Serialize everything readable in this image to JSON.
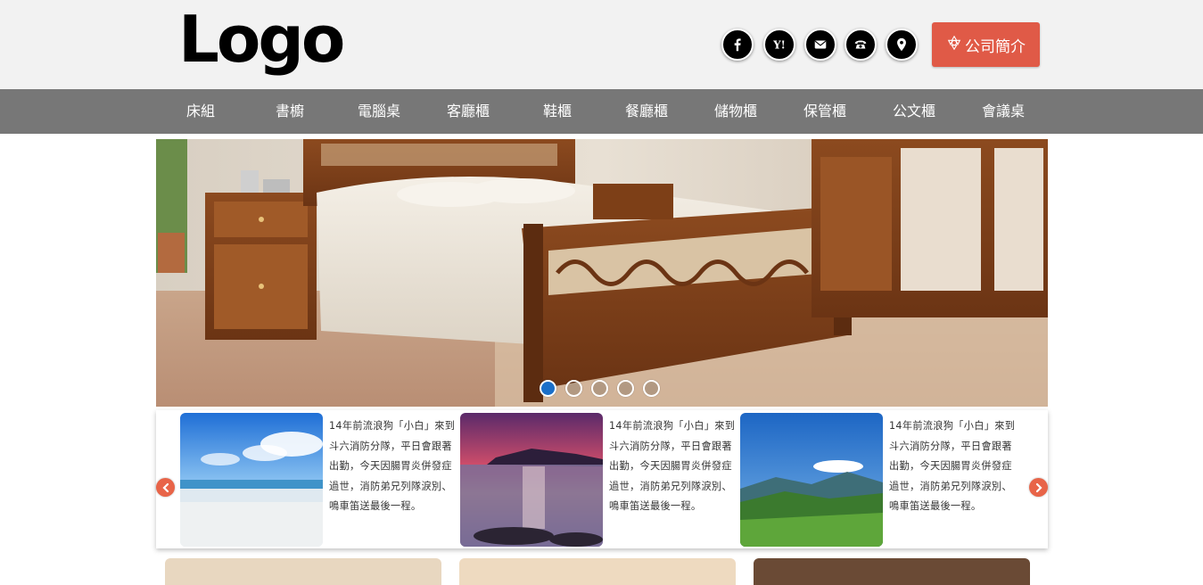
{
  "header": {
    "logo_text": "Logo",
    "social": [
      {
        "icon": "facebook-icon"
      },
      {
        "icon": "yahoo-icon"
      },
      {
        "icon": "mail-icon"
      },
      {
        "icon": "phone-icon"
      },
      {
        "icon": "location-pin-icon"
      }
    ],
    "about_label": "公司簡介",
    "about_color": "#e05a47"
  },
  "nav": {
    "background": "#777777",
    "items": [
      "床組",
      "書櫥",
      "電腦桌",
      "客廳櫃",
      "鞋櫃",
      "餐廳櫃",
      "儲物櫃",
      "保管櫃",
      "公文櫃",
      "會議桌"
    ]
  },
  "hero": {
    "slide_count": 5,
    "active_slide": 1,
    "active_dot_color": "#1a6fc9"
  },
  "carousel": {
    "cards": [
      {
        "image": "beach-photo",
        "text": "14年前流浪狗「小白」來到斗六消防分隊，平日會跟著出勤，今天因腸胃炎併發症過世，消防弟兄列隊淚別、鳴車笛送最後一程。"
      },
      {
        "image": "sunset-lake-photo",
        "text": "14年前流浪狗「小白」來到斗六消防分隊，平日會跟著出勤，今天因腸胃炎併發症過世，消防弟兄列隊淚別、鳴車笛送最後一程。"
      },
      {
        "image": "mountain-meadow-photo",
        "text": "14年前流浪狗「小白」來到斗六消防分隊，平日會跟著出勤，今天因腸胃炎併發症過世，消防弟兄列隊淚別、鳴車笛送最後一程。"
      }
    ],
    "arrow_color": "#e86448"
  }
}
